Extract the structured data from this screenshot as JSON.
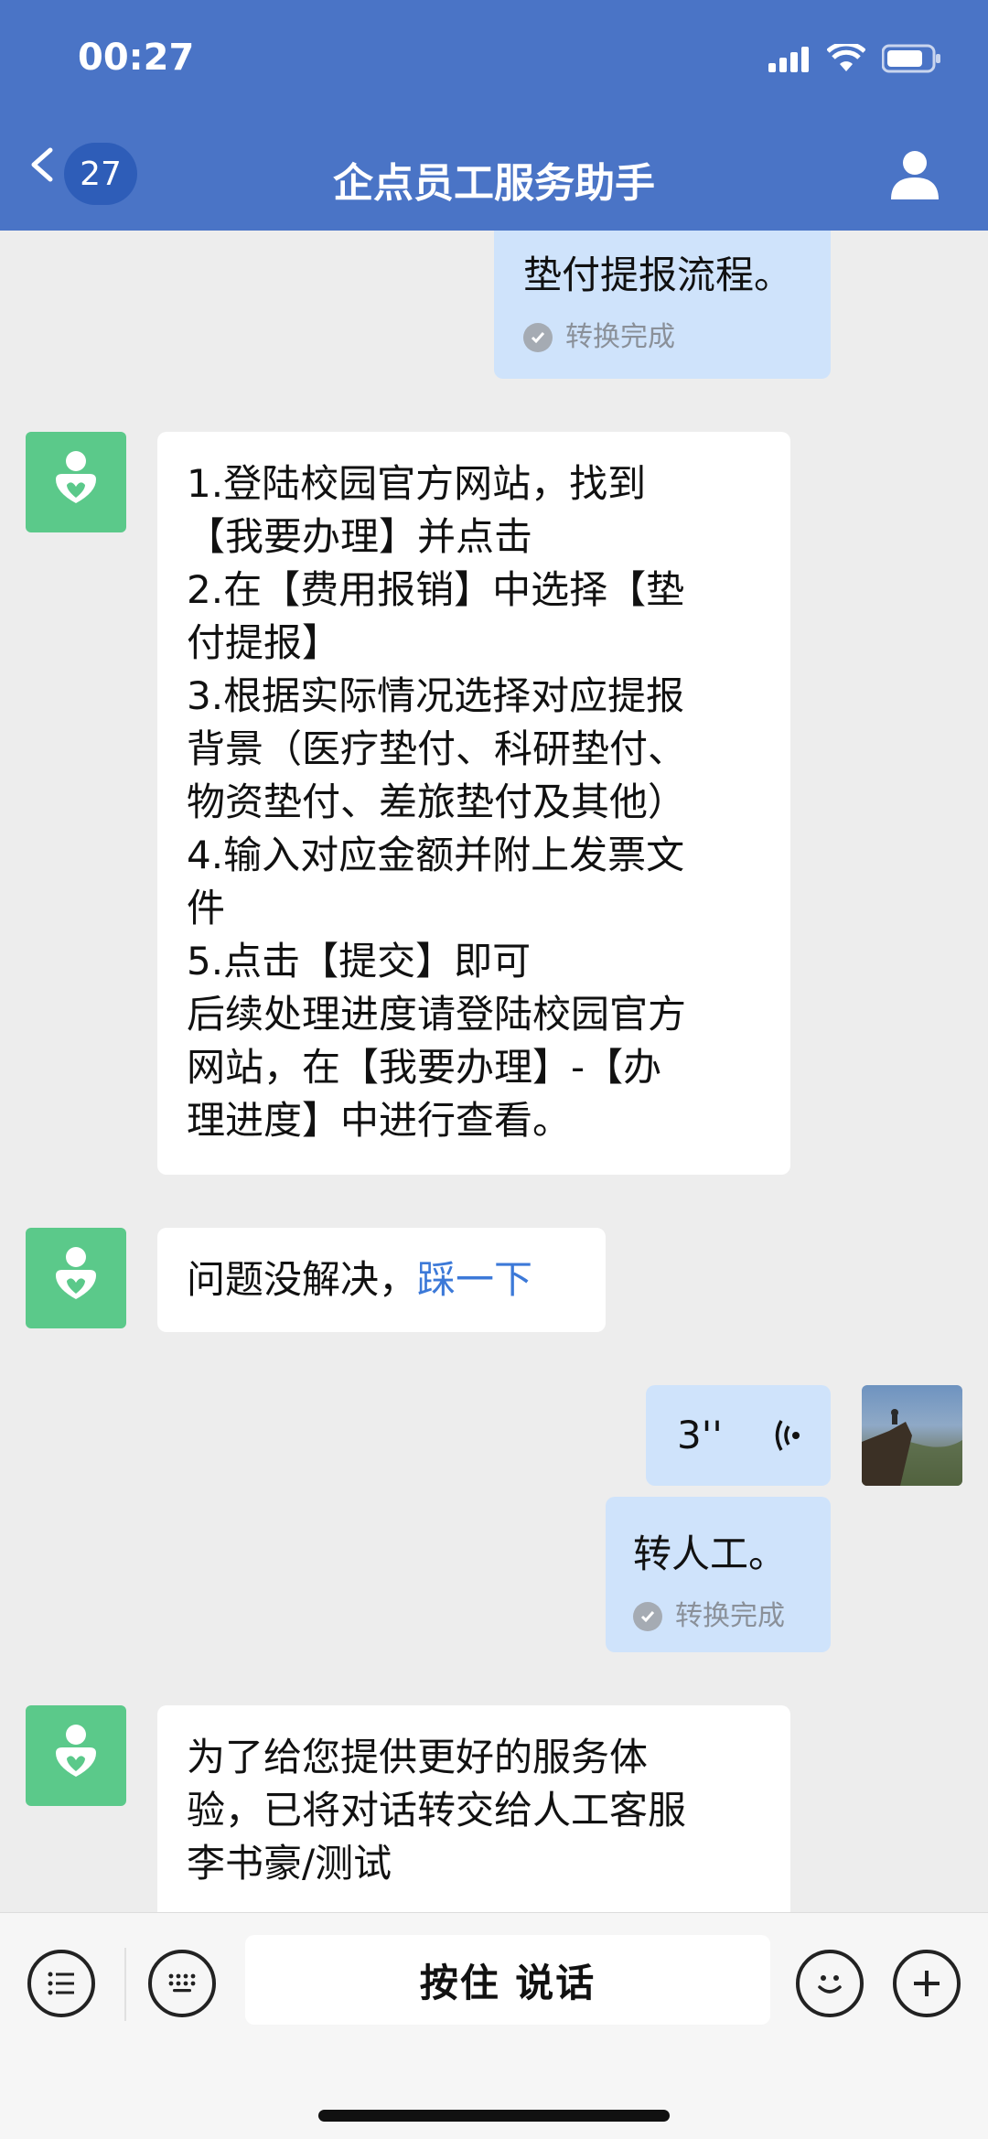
{
  "status_bar": {
    "time": "00:27"
  },
  "nav": {
    "back_count": "27",
    "title": "企点员工服务助手"
  },
  "messages": {
    "m1": {
      "text": "垫付提报流程。",
      "status": "转换完成"
    },
    "m2": {
      "lines": [
        "1.登陆校园官方网站，找到",
        "【我要办理】并点击",
        "2.在【费用报销】中选择【垫",
        "付提报】",
        "3.根据实际情况选择对应提报",
        "背景（医疗垫付、科研垫付、",
        "物资垫付、差旅垫付及其他）",
        "4.输入对应金额并附上发票文",
        "件",
        "5.点击【提交】即可",
        "后续处理进度请登陆校园官方",
        "网站，在【我要办理】-【办",
        "理进度】中进行查看。"
      ]
    },
    "m3": {
      "text": "问题没解决，",
      "link": "踩一下"
    },
    "m4": {
      "duration": "3''"
    },
    "m5": {
      "text": "转人工。",
      "status": "转换完成"
    },
    "m6": {
      "lines": [
        "为了给您提供更好的服务体",
        "验，已将对话转交给人工客服",
        "李书豪/测试"
      ]
    }
  },
  "input_bar": {
    "talk_label": "按住 说话"
  },
  "colors": {
    "header": "#4A74C6",
    "bot_avatar": "#5BC98A",
    "user_bubble": "#CFE3FB",
    "link": "#3C79D8"
  }
}
